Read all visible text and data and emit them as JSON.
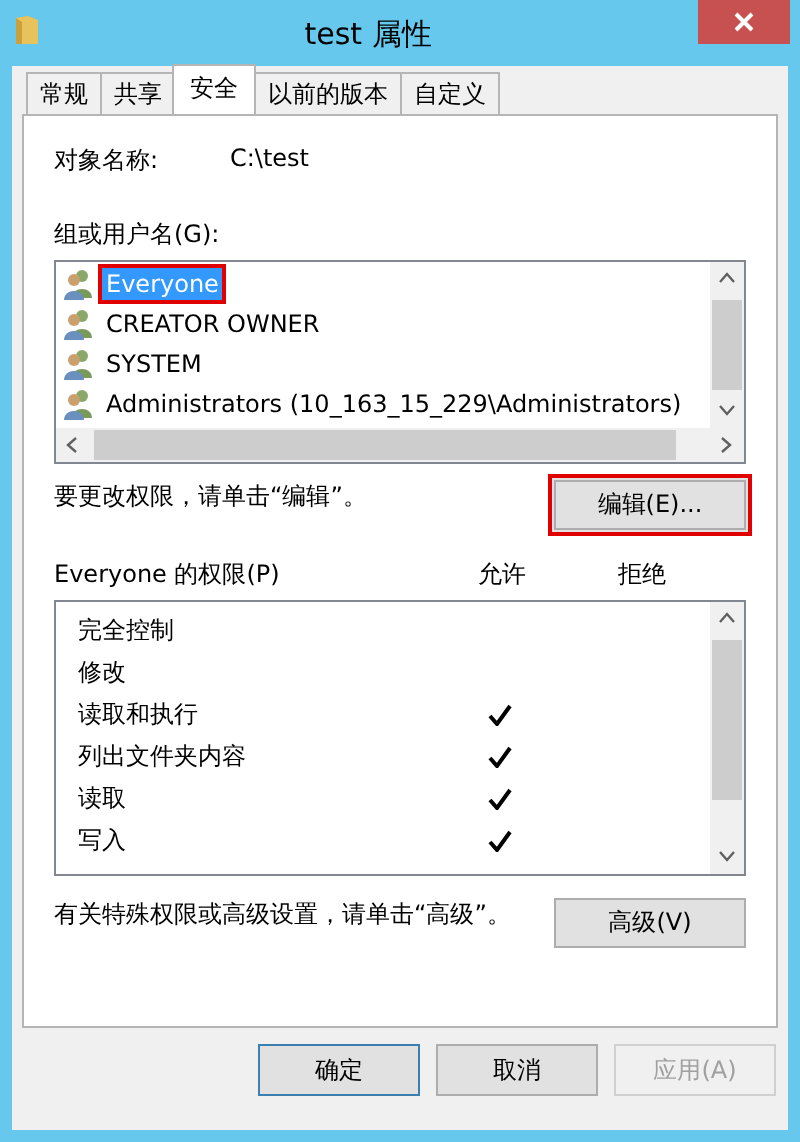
{
  "window": {
    "title": "test 属性"
  },
  "tabs": [
    {
      "label": "常规",
      "selected": false
    },
    {
      "label": "共享",
      "selected": false
    },
    {
      "label": "安全",
      "selected": true
    },
    {
      "label": "以前的版本",
      "selected": false
    },
    {
      "label": "自定义",
      "selected": false
    }
  ],
  "object_name": {
    "label": "对象名称:",
    "value": "C:\\test"
  },
  "groups": {
    "label": "组或用户名(G):",
    "items": [
      {
        "name": "Everyone",
        "selected": true,
        "highlighted": true
      },
      {
        "name": "CREATOR OWNER",
        "selected": false,
        "highlighted": false
      },
      {
        "name": "SYSTEM",
        "selected": false,
        "highlighted": false
      },
      {
        "name": "Administrators (10_163_15_229\\Administrators)",
        "selected": false,
        "highlighted": false
      }
    ]
  },
  "edit_hint": "要更改权限，请单击“编辑”。",
  "edit_button": {
    "label": "编辑(E)...",
    "highlighted": true
  },
  "permissions": {
    "label": "Everyone 的权限(P)",
    "allow_header": "允许",
    "deny_header": "拒绝",
    "rows": [
      {
        "name": "完全控制",
        "allow": false,
        "deny": false
      },
      {
        "name": "修改",
        "allow": false,
        "deny": false
      },
      {
        "name": "读取和执行",
        "allow": true,
        "deny": false
      },
      {
        "name": "列出文件夹内容",
        "allow": true,
        "deny": false
      },
      {
        "name": "读取",
        "allow": true,
        "deny": false
      },
      {
        "name": "写入",
        "allow": true,
        "deny": false
      }
    ]
  },
  "advanced_hint": "有关特殊权限或高级设置，请单击“高级”。",
  "advanced_button": "高级(V)",
  "buttons": [
    {
      "label": "确定",
      "disabled": false,
      "default": true
    },
    {
      "label": "取消",
      "disabled": false,
      "default": false
    },
    {
      "label": "应用(A)",
      "disabled": true,
      "default": false
    }
  ]
}
